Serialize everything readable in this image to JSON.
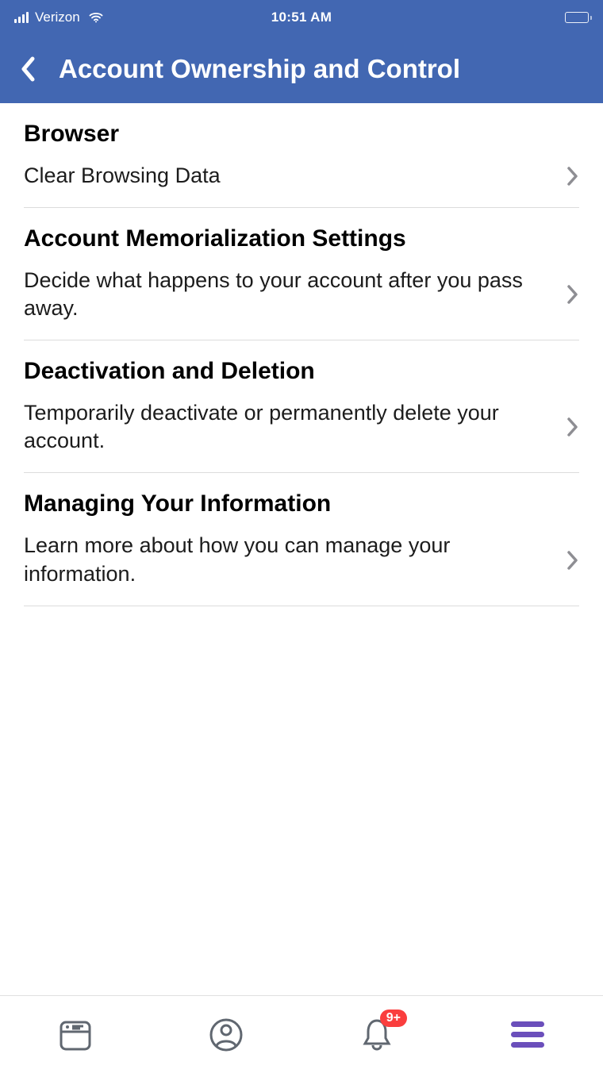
{
  "status_bar": {
    "carrier": "Verizon",
    "time": "10:51 AM"
  },
  "header": {
    "title": "Account Ownership and Control"
  },
  "sections": [
    {
      "title": "Browser",
      "subtitle": "Clear Browsing Data"
    },
    {
      "title": "Account Memorialization Settings",
      "subtitle": "Decide what happens to your account after you pass away."
    },
    {
      "title": "Deactivation and Deletion",
      "subtitle": "Temporarily deactivate or permanently delete your account."
    },
    {
      "title": "Managing Your Information",
      "subtitle": "Learn more about how you can manage your information."
    }
  ],
  "tab_bar": {
    "badge": "9+"
  }
}
